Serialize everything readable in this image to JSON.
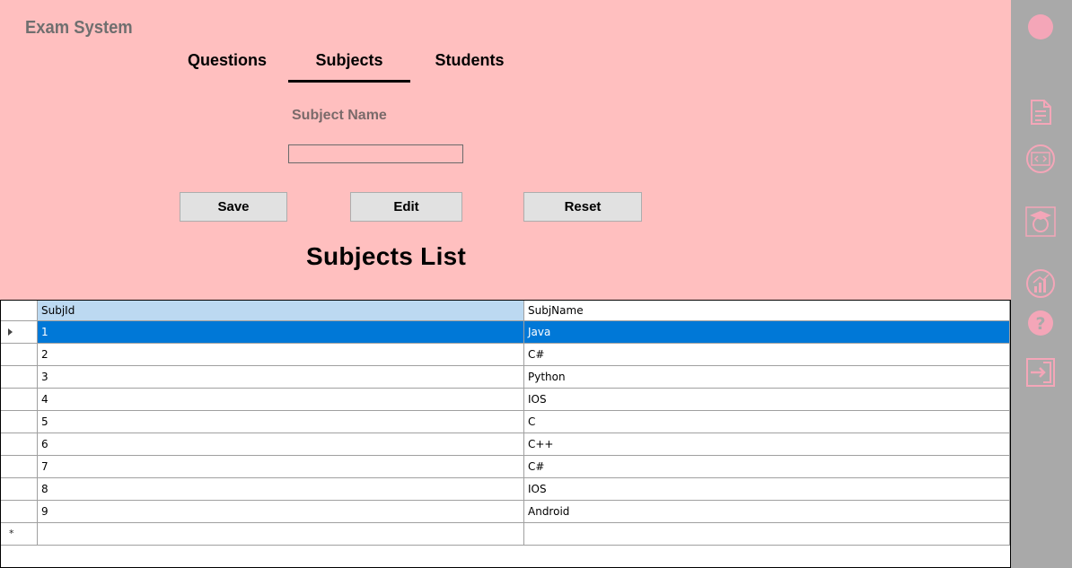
{
  "app": {
    "title": "Exam System"
  },
  "tabs": [
    {
      "label": "Questions"
    },
    {
      "label": "Subjects"
    },
    {
      "label": "Students"
    }
  ],
  "form": {
    "subject_label": "Subject Name",
    "subject_value": "",
    "save_label": "Save",
    "edit_label": "Edit",
    "reset_label": "Reset"
  },
  "list": {
    "title": "Subjects List",
    "columns": [
      "SubjId",
      "SubjName"
    ],
    "rows": [
      {
        "id": "1",
        "name": "Java"
      },
      {
        "id": "2",
        "name": "C#"
      },
      {
        "id": "3",
        "name": "Python"
      },
      {
        "id": "4",
        "name": "IOS"
      },
      {
        "id": "5",
        "name": "C"
      },
      {
        "id": "6",
        "name": "C++"
      },
      {
        "id": "7",
        "name": "C#"
      },
      {
        "id": "8",
        "name": "IOS"
      },
      {
        "id": "9",
        "name": "Android"
      }
    ],
    "new_row_marker": "*"
  },
  "sidebar": {
    "icons": [
      "profile-icon",
      "document-icon",
      "code-icon",
      "student-icon",
      "results-icon",
      "help-icon",
      "logout-icon"
    ]
  },
  "colors": {
    "background": "#ffbfbf",
    "sidebar": "#a9a9a9",
    "icon": "#f4a6b8",
    "selection": "#0078d7",
    "header_highlight": "#bcd9f1"
  }
}
